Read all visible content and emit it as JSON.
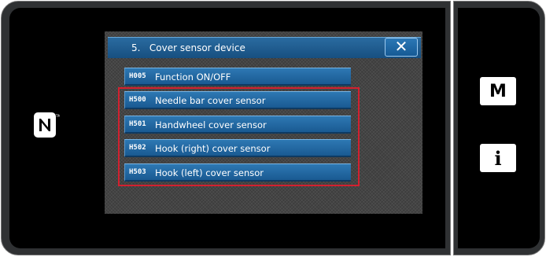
{
  "dialog": {
    "title": "5.   Cover sensor device",
    "close_label": "✕"
  },
  "menu_items": [
    {
      "code": "H005",
      "label": "Function ON/OFF",
      "highlighted": false
    },
    {
      "code": "H500",
      "label": "Needle bar cover sensor",
      "highlighted": true
    },
    {
      "code": "H501",
      "label": "Handwheel cover sensor",
      "highlighted": true
    },
    {
      "code": "H502",
      "label": "Hook (right) cover sensor",
      "highlighted": true
    },
    {
      "code": "H503",
      "label": "Hook (left) cover sensor",
      "highlighted": true
    }
  ],
  "side_keys": {
    "mode_label": "M",
    "info_label": "i"
  },
  "icons": {
    "nfc": "nfc-icon",
    "close": "close-icon"
  },
  "colors": {
    "button_blue": "#1a5a92",
    "title_blue": "#174f80",
    "highlight_red": "#d3202f",
    "screen_gray": "#3d3d3d"
  }
}
